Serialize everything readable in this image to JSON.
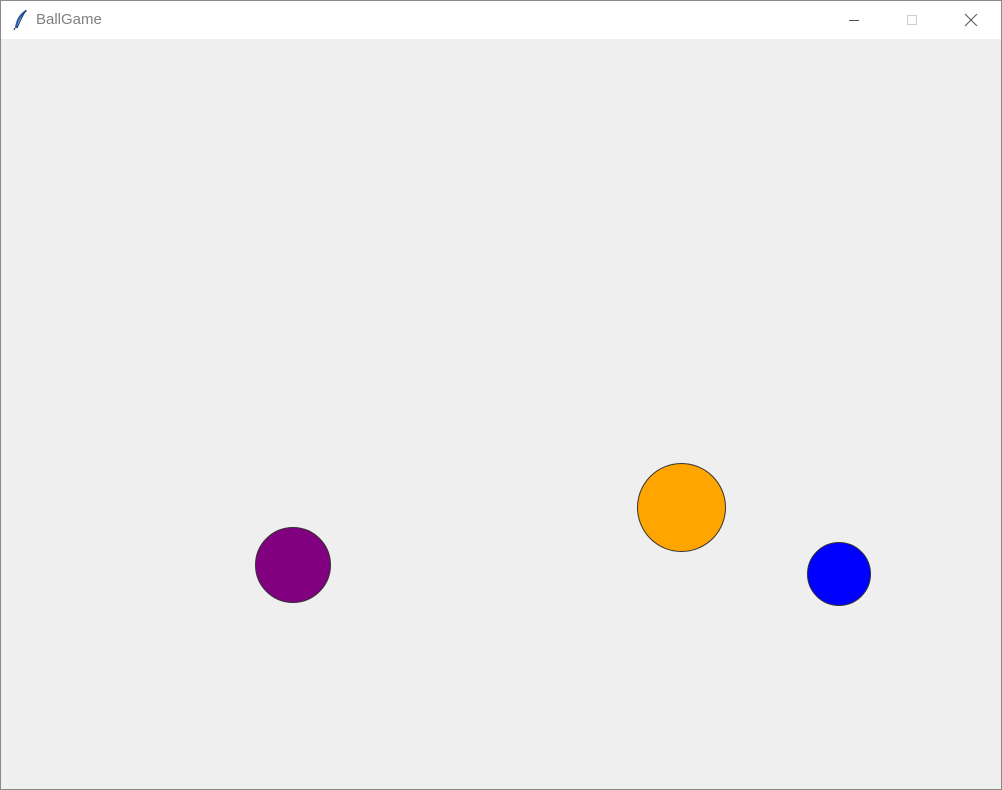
{
  "window": {
    "title": "BallGame",
    "app_icon": "feather-icon",
    "controls": {
      "minimize": "minimize-icon",
      "maximize": "maximize-icon",
      "close": "close-icon"
    }
  },
  "canvas": {
    "background": "#efefef",
    "balls": [
      {
        "color": "#800080"
      },
      {
        "color": "#ffa500"
      },
      {
        "color": "#0000ff"
      }
    ]
  }
}
